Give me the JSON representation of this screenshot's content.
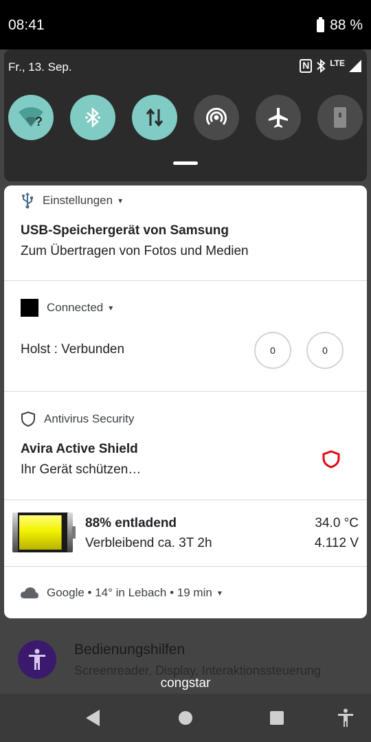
{
  "status_bar": {
    "time": "08:41",
    "battery": "88 %"
  },
  "quick_settings": {
    "date": "Fr., 13. Sep.",
    "network_type": "LTE",
    "tiles": [
      {
        "name": "wifi-unknown",
        "state": "on"
      },
      {
        "name": "bluetooth",
        "state": "on"
      },
      {
        "name": "mobile-data",
        "state": "on"
      },
      {
        "name": "hotspot",
        "state": "off"
      },
      {
        "name": "airplane-mode",
        "state": "off"
      },
      {
        "name": "flashlight",
        "state": "off"
      }
    ]
  },
  "notifications": {
    "usb": {
      "app": "Einstellungen",
      "title": "USB-Speichergerät von Samsung",
      "text": "Zum Übertragen von Fotos und Medien"
    },
    "connected": {
      "app": "Connected",
      "text": "Holst : Verbunden",
      "counter_1": "0",
      "counter_2": "0"
    },
    "antivirus": {
      "app": "Antivirus Security",
      "title": "Avira Active Shield",
      "text": "Ihr Gerät schützen…"
    },
    "battery": {
      "level": 0.88,
      "title": "88% entladend",
      "remaining": "Verbleibend ca. 3T 2h",
      "temperature": "34.0 °C",
      "voltage": "4.112 V"
    },
    "weather": {
      "summary": "Google • 14° in Lebach • 19 min"
    }
  },
  "background_app": {
    "title": "Bedienungshilfen",
    "subtitle": "Screenreader, Display, Interaktionssteuerung"
  },
  "carrier": "congstar",
  "colors": {
    "tile_on": "#80cbc4",
    "tile_off": "#4a4a4a",
    "shield_red": "#e30613",
    "battery_yellow": "#f2f200"
  }
}
